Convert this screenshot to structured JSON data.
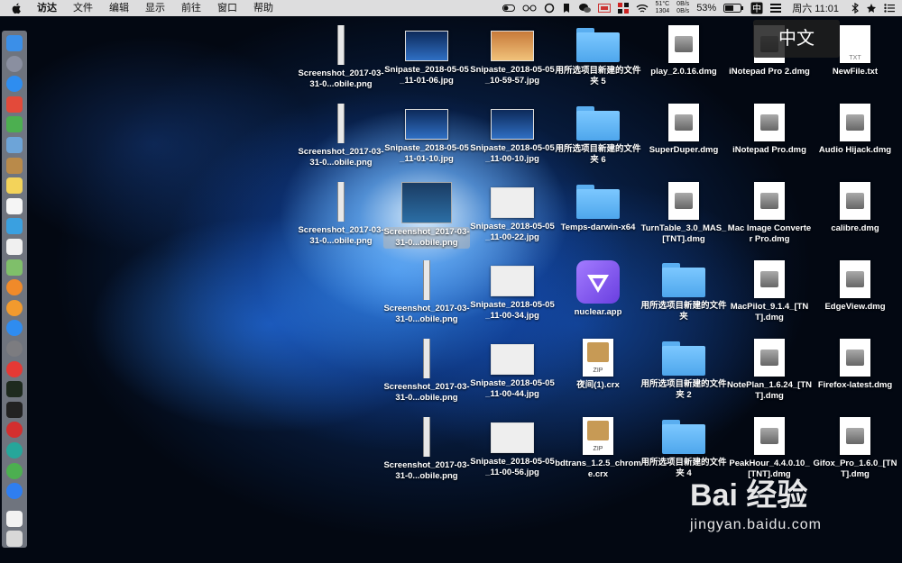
{
  "menubar": {
    "app_name": "访达",
    "items": [
      "文件",
      "编辑",
      "显示",
      "前往",
      "窗口",
      "帮助"
    ],
    "status": {
      "temp": "51°C",
      "rpm": "1304",
      "net_up": "0B/s",
      "net_down": "0B/s",
      "battery": "53%",
      "clock": "周六 11:01"
    }
  },
  "ime_indicator": "中文",
  "watermark": {
    "brand": "Bai 经验",
    "url": "jingyan.baidu.com"
  },
  "desktop": {
    "columns": [
      {
        "items": [
          {
            "label": "Screenshot_2017-03-31-0...obile.png",
            "kind": "strip"
          },
          {
            "label": "Screenshot_2017-03-31-0...obile.png",
            "kind": "strip"
          },
          {
            "label": "Screenshot_2017-03-31-0...obile.png",
            "kind": "strip"
          }
        ]
      },
      {
        "items": [
          {
            "label": "Snipaste_2018-05-05_11-01-06.jpg",
            "kind": "thumb-dark"
          },
          {
            "label": "Snipaste_2018-05-05_11-01-10.jpg",
            "kind": "thumb-dark"
          },
          {
            "label": "Screenshot_2017-03-31-0...obile.png",
            "kind": "strip-selected",
            "selected": true
          },
          {
            "label": "Screenshot_2017-03-31-0...obile.png",
            "kind": "strip"
          },
          {
            "label": "Screenshot_2017-03-31-0...obile.png",
            "kind": "strip"
          },
          {
            "label": "Screenshot_2017-03-31-0...obile.png",
            "kind": "strip"
          }
        ]
      },
      {
        "items": [
          {
            "label": "Snipaste_2018-05-05_10-59-57.jpg",
            "kind": "thumb-photo"
          },
          {
            "label": "Snipaste_2018-05-05_11-00-10.jpg",
            "kind": "thumb-dark"
          },
          {
            "label": "Snipaste_2018-05-05_11-00-22.jpg",
            "kind": "thumb-light"
          },
          {
            "label": "Snipaste_2018-05-05_11-00-34.jpg",
            "kind": "thumb-light"
          },
          {
            "label": "Snipaste_2018-05-05_11-00-44.jpg",
            "kind": "thumb-light"
          },
          {
            "label": "Snipaste_2018-05-05_11-00-56.jpg",
            "kind": "thumb-light"
          }
        ]
      },
      {
        "items": [
          {
            "label": "用所选项目新建的文件夹 5",
            "kind": "folder"
          },
          {
            "label": "用所选项目新建的文件夹 6",
            "kind": "folder"
          },
          {
            "label": "Temps-darwin-x64",
            "kind": "folder"
          },
          {
            "label": "nuclear.app",
            "kind": "app"
          },
          {
            "label": "夜间(1).crx",
            "kind": "zip"
          },
          {
            "label": "bdtrans_1.2.5_chrome.crx",
            "kind": "zip"
          }
        ]
      },
      {
        "items": [
          {
            "label": "play_2.0.16.dmg",
            "kind": "dmg"
          },
          {
            "label": "SuperDuper.dmg",
            "kind": "dmg"
          },
          {
            "label": "TurnTable_3.0_MAS_[TNT].dmg",
            "kind": "dmg"
          },
          {
            "label": "用所选项目新建的文件夹",
            "kind": "folder"
          },
          {
            "label": "用所选项目新建的文件夹 2",
            "kind": "folder"
          },
          {
            "label": "用所选项目新建的文件夹 4",
            "kind": "folder"
          }
        ]
      },
      {
        "items": [
          {
            "label": "iNotepad Pro 2.dmg",
            "kind": "dmg"
          },
          {
            "label": "iNotepad Pro.dmg",
            "kind": "dmg"
          },
          {
            "label": "Mac Image Converter Pro.dmg",
            "kind": "dmg"
          },
          {
            "label": "MacPilot_9.1.4_[TNT].dmg",
            "kind": "dmg"
          },
          {
            "label": "NotePlan_1.6.24_[TNT].dmg",
            "kind": "dmg"
          },
          {
            "label": "PeakHour_4.4.0.10_[TNT].dmg",
            "kind": "dmg"
          }
        ]
      },
      {
        "items": [
          {
            "label": "NewFile.txt",
            "kind": "txt",
            "badge": "TXT"
          },
          {
            "label": "Audio Hijack.dmg",
            "kind": "dmg"
          },
          {
            "label": "calibre.dmg",
            "kind": "dmg"
          },
          {
            "label": "EdgeView.dmg",
            "kind": "dmg"
          },
          {
            "label": "Firefox-latest.dmg",
            "kind": "dmg"
          },
          {
            "label": "Gifox_Pro_1.6.0_[TNT].dmg",
            "kind": "dmg"
          }
        ]
      }
    ]
  },
  "dock": {
    "icons": [
      {
        "name": "finder-icon",
        "color": "#3b8fe8"
      },
      {
        "name": "launchpad-icon",
        "color": "#8a8fa0"
      },
      {
        "name": "safari-icon",
        "color": "#2e8df0"
      },
      {
        "name": "nettoolbox-icon",
        "color": "#e34a3a"
      },
      {
        "name": "android-studio-icon",
        "color": "#4caf50"
      },
      {
        "name": "preview-icon",
        "color": "#6da4d8"
      },
      {
        "name": "notes-brown-icon",
        "color": "#b98a4a"
      },
      {
        "name": "notes-icon",
        "color": "#f3d35a"
      },
      {
        "name": "calendar-icon",
        "color": "#f5f5f5"
      },
      {
        "name": "finder-search-icon",
        "color": "#3aa0e0"
      },
      {
        "name": "reminders-icon",
        "color": "#f0f0f0"
      },
      {
        "name": "maps-icon",
        "color": "#7fbf6a"
      },
      {
        "name": "photos-icon",
        "color": "#f08a2a"
      },
      {
        "name": "books-icon",
        "color": "#f29a2e"
      },
      {
        "name": "app-store-icon",
        "color": "#2f8cf0"
      },
      {
        "name": "system-preferences-icon",
        "color": "#7c7c80"
      },
      {
        "name": "vivaldi-icon",
        "color": "#e53935"
      },
      {
        "name": "activity-monitor-icon",
        "color": "#1e2a1e"
      },
      {
        "name": "terminal-icon",
        "color": "#222"
      },
      {
        "name": "netease-music-icon",
        "color": "#d32f2f"
      },
      {
        "name": "teal-app-icon",
        "color": "#26a69a"
      },
      {
        "name": "wechat-icon",
        "color": "#4caf50"
      },
      {
        "name": "baidu-netdisk-icon",
        "color": "#2f7ef0"
      },
      {
        "name": "document-icon",
        "color": "#f2f2f2"
      },
      {
        "name": "trash-icon",
        "color": "#d8d8d8"
      }
    ]
  }
}
